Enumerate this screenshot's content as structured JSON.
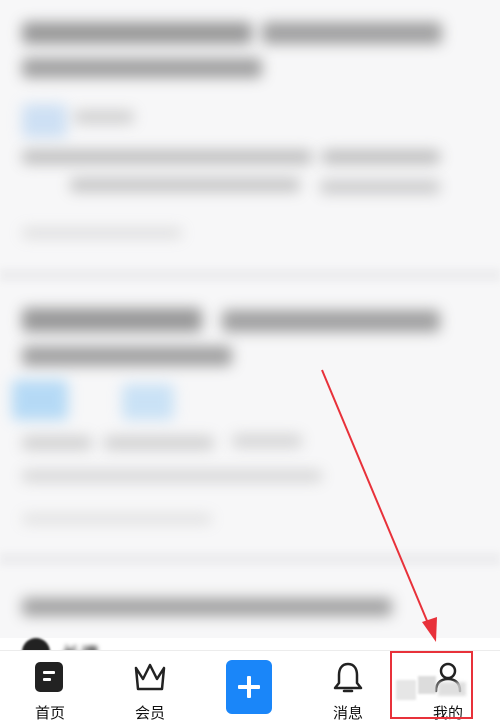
{
  "tabbar": {
    "home_label": "首页",
    "vip_label": "会员",
    "messages_label": "消息",
    "mine_label": "我的"
  },
  "feed": {
    "next_post_author_partial": "长调…"
  },
  "colors": {
    "post_button": "#1a86f9",
    "annotation_red": "#e8313a",
    "tab_icon": "#222222"
  },
  "icons": {
    "home": "doc-square-icon",
    "vip": "crown-icon",
    "post": "plus-icon",
    "messages": "bell-icon",
    "mine": "person-icon"
  }
}
